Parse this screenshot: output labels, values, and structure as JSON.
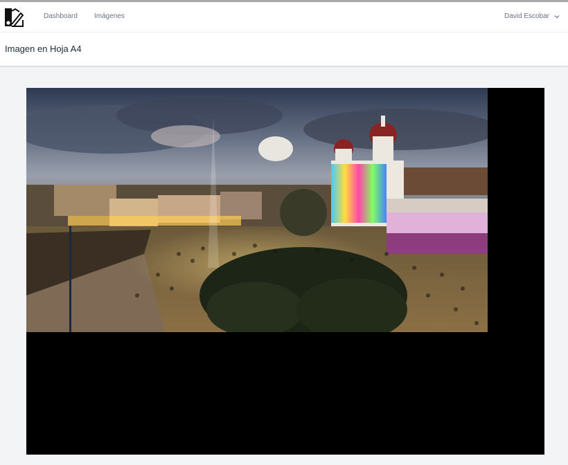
{
  "nav": {
    "logo_icon": "swatch-book-icon",
    "links": [
      {
        "label": "Dashboard"
      },
      {
        "label": "Imágenes"
      }
    ],
    "user": {
      "name": "David Escobar",
      "icon": "chevron-down-icon"
    }
  },
  "header": {
    "title": "Imagen en Hoja A4"
  },
  "sheet": {
    "background": "#000000",
    "image": {
      "subject": "night-plaza-cathedral-light-show"
    }
  }
}
